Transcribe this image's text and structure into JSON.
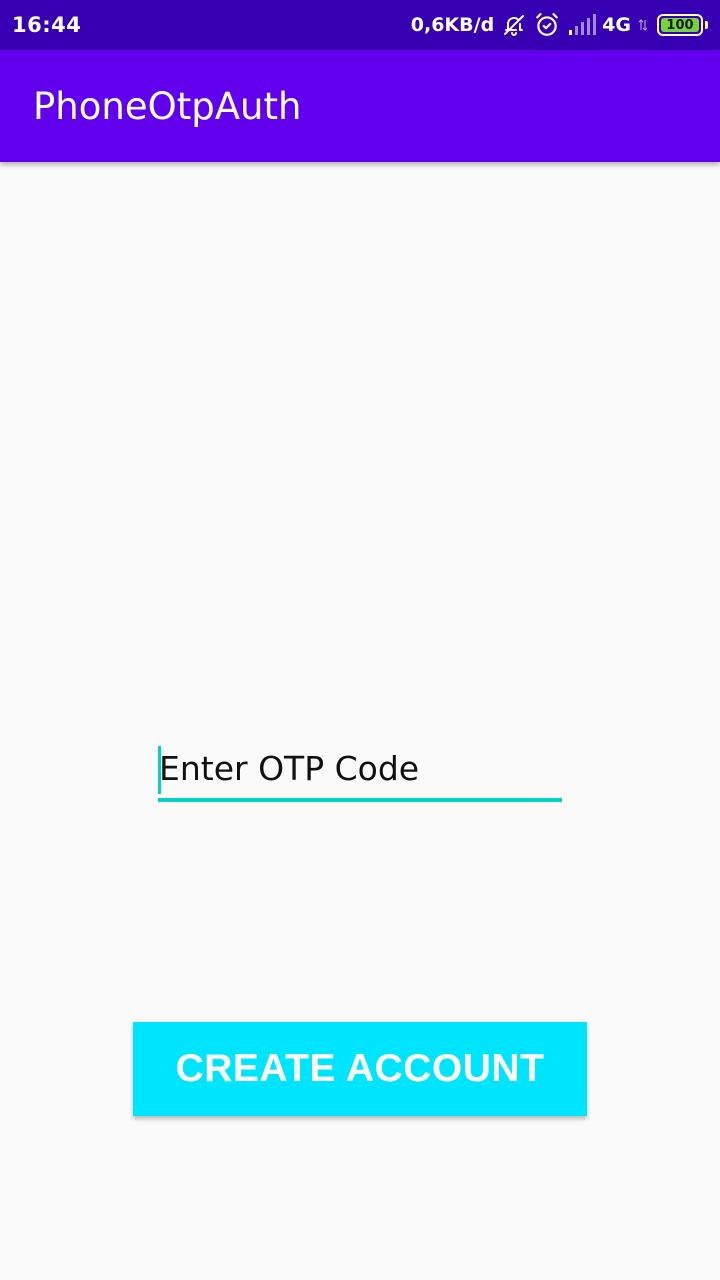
{
  "status_bar": {
    "time": "16:44",
    "net_speed": "0,6KB/d",
    "network_type": "4G",
    "battery_level": "100",
    "icons": [
      "bell-off-icon",
      "alarm-icon",
      "signal-icon",
      "battery-icon"
    ]
  },
  "app_bar": {
    "title": "PhoneOtpAuth"
  },
  "otp": {
    "placeholder": "Enter OTP Code",
    "value": ""
  },
  "actions": {
    "create_account_label": "CREATE ACCOUNT"
  },
  "colors": {
    "status_bar": "#3700b3",
    "app_bar": "#6200ee",
    "accent": "#03d0c6",
    "button": "#00e5ff",
    "background": "#fafafa",
    "battery_fill": "#76d43a"
  }
}
